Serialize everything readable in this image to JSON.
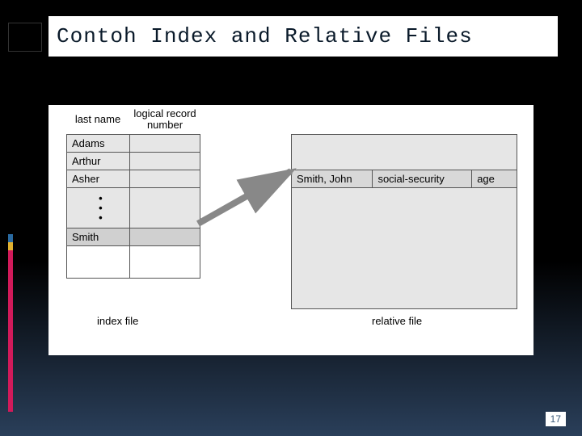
{
  "title": "Contoh Index and Relative Files",
  "index": {
    "headers": {
      "col_a": "last name",
      "col_b": "logical record\nnumber"
    },
    "rows": [
      "Adams",
      "Arthur",
      "Asher"
    ],
    "highlight_row": "Smith",
    "footer": "index file"
  },
  "relative": {
    "record": {
      "name": "Smith, John",
      "ssn": "social-security",
      "age": "age"
    },
    "footer": "relative file"
  },
  "page_number": "17"
}
